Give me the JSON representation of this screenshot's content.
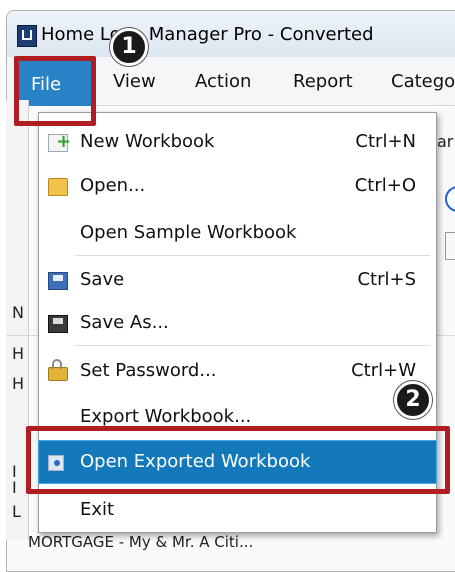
{
  "window": {
    "title": "Home Loan Manager Pro - Converted"
  },
  "menubar": {
    "items": [
      "File",
      "View",
      "Action",
      "Report",
      "Catego"
    ]
  },
  "file_menu": [
    {
      "label": "New Workbook",
      "shortcut": "Ctrl+N",
      "icon": "new-workbook-icon"
    },
    {
      "label": "Open...",
      "shortcut": "Ctrl+O",
      "icon": "open-folder-icon"
    },
    {
      "label": "Open Sample Workbook",
      "shortcut": "",
      "icon": ""
    },
    {
      "label": "Save",
      "shortcut": "Ctrl+S",
      "icon": "save-disk-icon"
    },
    {
      "label": "Save As...",
      "shortcut": "",
      "icon": "save-as-icon"
    },
    {
      "label": "Set Password...",
      "shortcut": "Ctrl+W",
      "icon": "lock-icon"
    },
    {
      "label": "Export Workbook...",
      "shortcut": "",
      "icon": ""
    },
    {
      "label": "Open Exported Workbook",
      "shortcut": "",
      "icon": "open-exported-icon"
    },
    {
      "label": "Exit",
      "shortcut": "",
      "icon": ""
    }
  ],
  "callouts": {
    "step1": "1",
    "step2": "2"
  },
  "background": {
    "left_letters": [
      "N",
      "H",
      "H",
      "I",
      "I",
      "L"
    ],
    "right_fragment": "ar",
    "bottom_text": "MORTGAGE - My & Mr. A Citi..."
  },
  "colors": {
    "menu_highlight": "#1479ba",
    "file_active": "#2a82c6",
    "callout_red": "#b01e24"
  }
}
